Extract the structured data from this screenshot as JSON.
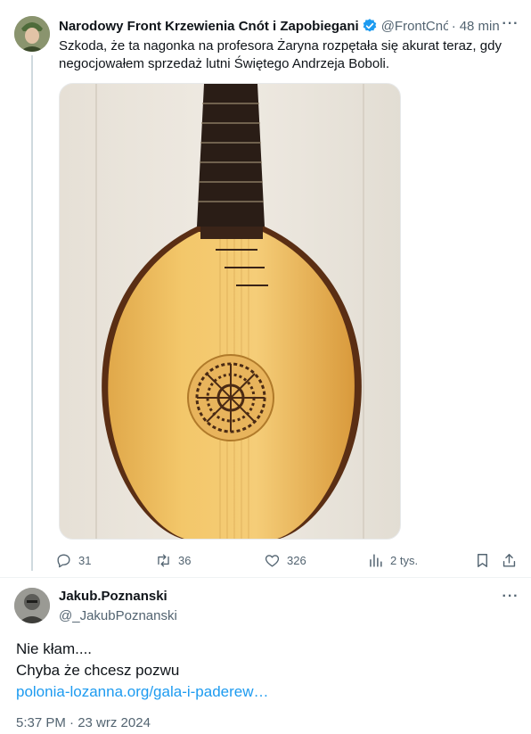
{
  "post": {
    "author_name": "Narodowy Front Krzewienia Cnót i Zapobiegani",
    "author_handle": "@FrontCnót",
    "separator": "·",
    "time": "48 min",
    "text": "Szkoda, że ta nagonka na profesora Żaryna rozpętała się akurat teraz, gdy negocjowałem sprzedaż lutni Świętego Andrzeja Boboli.",
    "media_icon": "lute-photo",
    "stats": {
      "replies": "31",
      "reposts": "36",
      "likes": "326",
      "views": "2 tys."
    }
  },
  "reply": {
    "author_name": "Jakub.Poznanski",
    "author_handle": "@_JakubPoznanski",
    "line1": "Nie kłam....",
    "line2": "Chyba że chcesz pozwu",
    "link": "polonia-lozanna.org/gala-i-paderew…",
    "timestamp": "5:37 PM · 23 wrz 2024"
  },
  "colors": {
    "accent": "#1d9bf0",
    "secondary_text": "#536471",
    "divider": "#eff3f4"
  }
}
